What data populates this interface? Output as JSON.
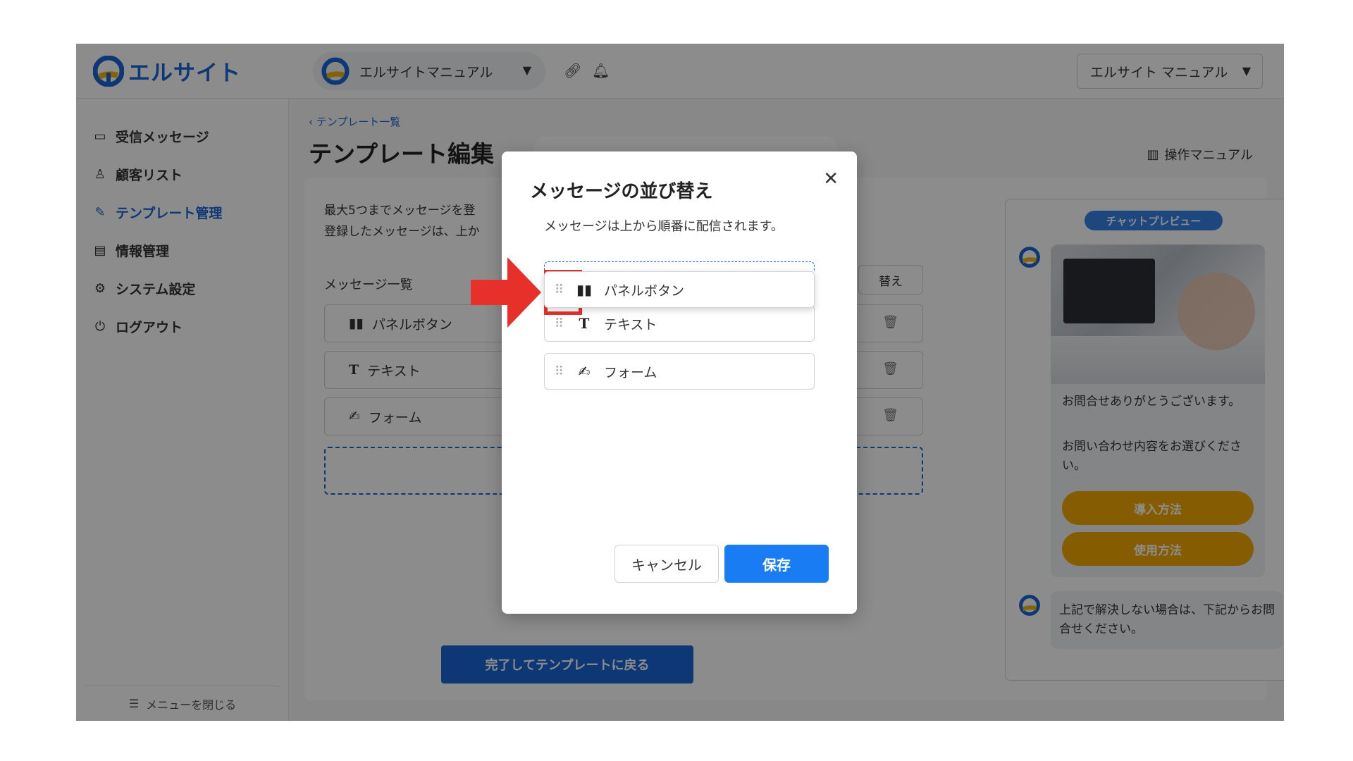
{
  "header": {
    "logo_text": "エルサイト",
    "account_name": "エルサイトマニュアル",
    "user_select": "エルサイト マニュアル",
    "link_icon": "link-icon",
    "bell_icon": "bell-icon"
  },
  "sidebar": {
    "items": [
      {
        "label": "受信メッセージ",
        "icon": "inbox-icon"
      },
      {
        "label": "顧客リスト",
        "icon": "user-icon"
      },
      {
        "label": "テンプレート管理",
        "icon": "edit-icon"
      },
      {
        "label": "情報管理",
        "icon": "info-icon"
      },
      {
        "label": "システム設定",
        "icon": "gear-icon"
      },
      {
        "label": "ログアウト",
        "icon": "logout-icon"
      }
    ],
    "close_menu": "メニューを閉じる"
  },
  "main": {
    "breadcrumb": "テンプレート一覧",
    "page_title": "テンプレート編集",
    "manual_link": "操作マニュアル",
    "desc_line1": "最大5つまでメッセージを登",
    "desc_line2": "登録したメッセージは、上か",
    "list_label": "メッセージ一覧",
    "swap_button": "替え",
    "messages": [
      "パネルボタン",
      "テキスト",
      "フォーム"
    ],
    "done_button": "完了してテンプレートに戻る"
  },
  "preview": {
    "badge": "チャットプレビュー",
    "text1": "お問合せありがとうございます。",
    "text2": "お問い合わせ内容をお選びください。",
    "button1": "導入方法",
    "button2": "使用方法",
    "text3": "上記で解決しない場合は、下記からお問合せください。"
  },
  "modal": {
    "title": "メッセージの並び替え",
    "subtitle": "メッセージは上から順番に配信されます。",
    "items": [
      "パネルボタン",
      "テキスト",
      "フォーム"
    ],
    "cancel": "キャンセル",
    "save": "保存"
  },
  "colors": {
    "brand_blue": "#1a66d6",
    "save_blue": "#1a7cf2",
    "preview_button": "#f2a900",
    "annotation_red": "#e8302a"
  }
}
